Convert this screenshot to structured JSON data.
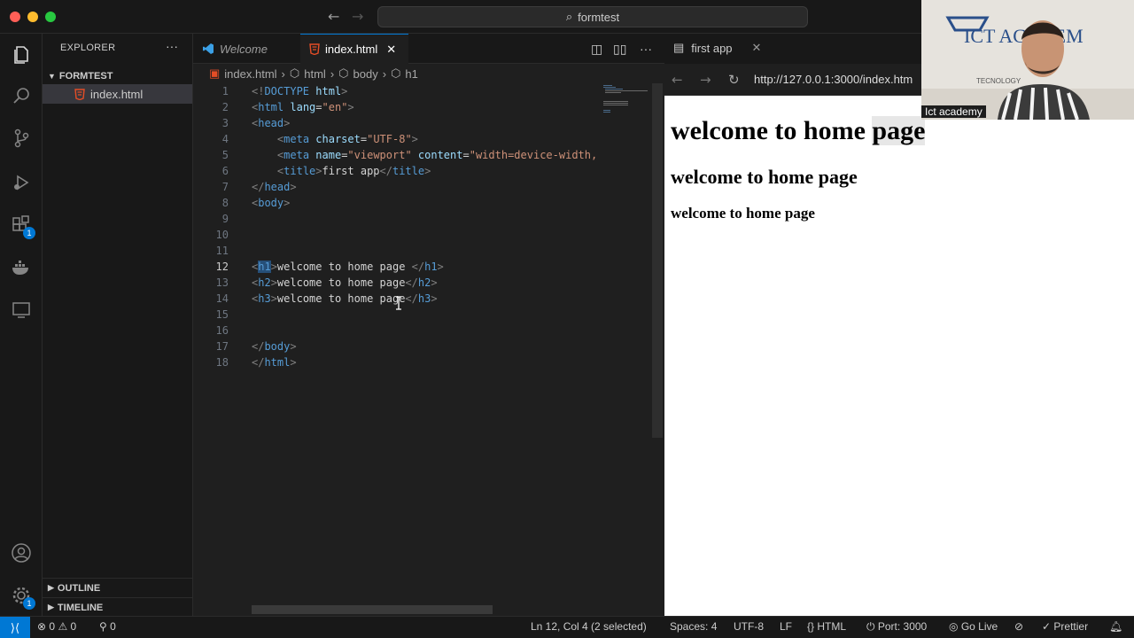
{
  "window": {
    "title": "formtest"
  },
  "activity_bar": {
    "extensions_badge": "1",
    "manage_badge": "1"
  },
  "sidebar": {
    "header": "EXPLORER",
    "folder": "FORMTEST",
    "file": "index.html",
    "panels": [
      "OUTLINE",
      "TIMELINE"
    ]
  },
  "editor": {
    "tabs": [
      {
        "label": "Welcome",
        "active": false
      },
      {
        "label": "index.html",
        "active": true
      }
    ],
    "breadcrumbs": [
      "index.html",
      "html",
      "body",
      "h1"
    ],
    "line_numbers": [
      "1",
      "2",
      "3",
      "4",
      "5",
      "6",
      "7",
      "8",
      "9",
      "10",
      "11",
      "12",
      "13",
      "14",
      "15",
      "16",
      "17",
      "18"
    ],
    "current_line": "12"
  },
  "browser": {
    "tab_title": "first app",
    "url": "http://127.0.0.1:3000/index.htm",
    "h1": "welcome to home page",
    "h2": "welcome to home page",
    "h3": "welcome to home page"
  },
  "webcam": {
    "caption": "Ict academy",
    "logo_text": "ICT ACADEM",
    "logo_sub": "TECNOLOGY"
  },
  "status_bar": {
    "errors": "0",
    "warnings": "0",
    "ports": "0",
    "position": "Ln 12, Col 4 (2 selected)",
    "spaces": "Spaces: 4",
    "encoding": "UTF-8",
    "eol": "LF",
    "language": "HTML",
    "port": "Port: 3000",
    "go_live": "Go Live",
    "prettier": "Prettier"
  },
  "colors": {
    "accent": "#0078d4",
    "editor_bg": "#1f1f1f",
    "tag": "#569cd6",
    "attr": "#9cdcfe",
    "string": "#ce9178"
  }
}
